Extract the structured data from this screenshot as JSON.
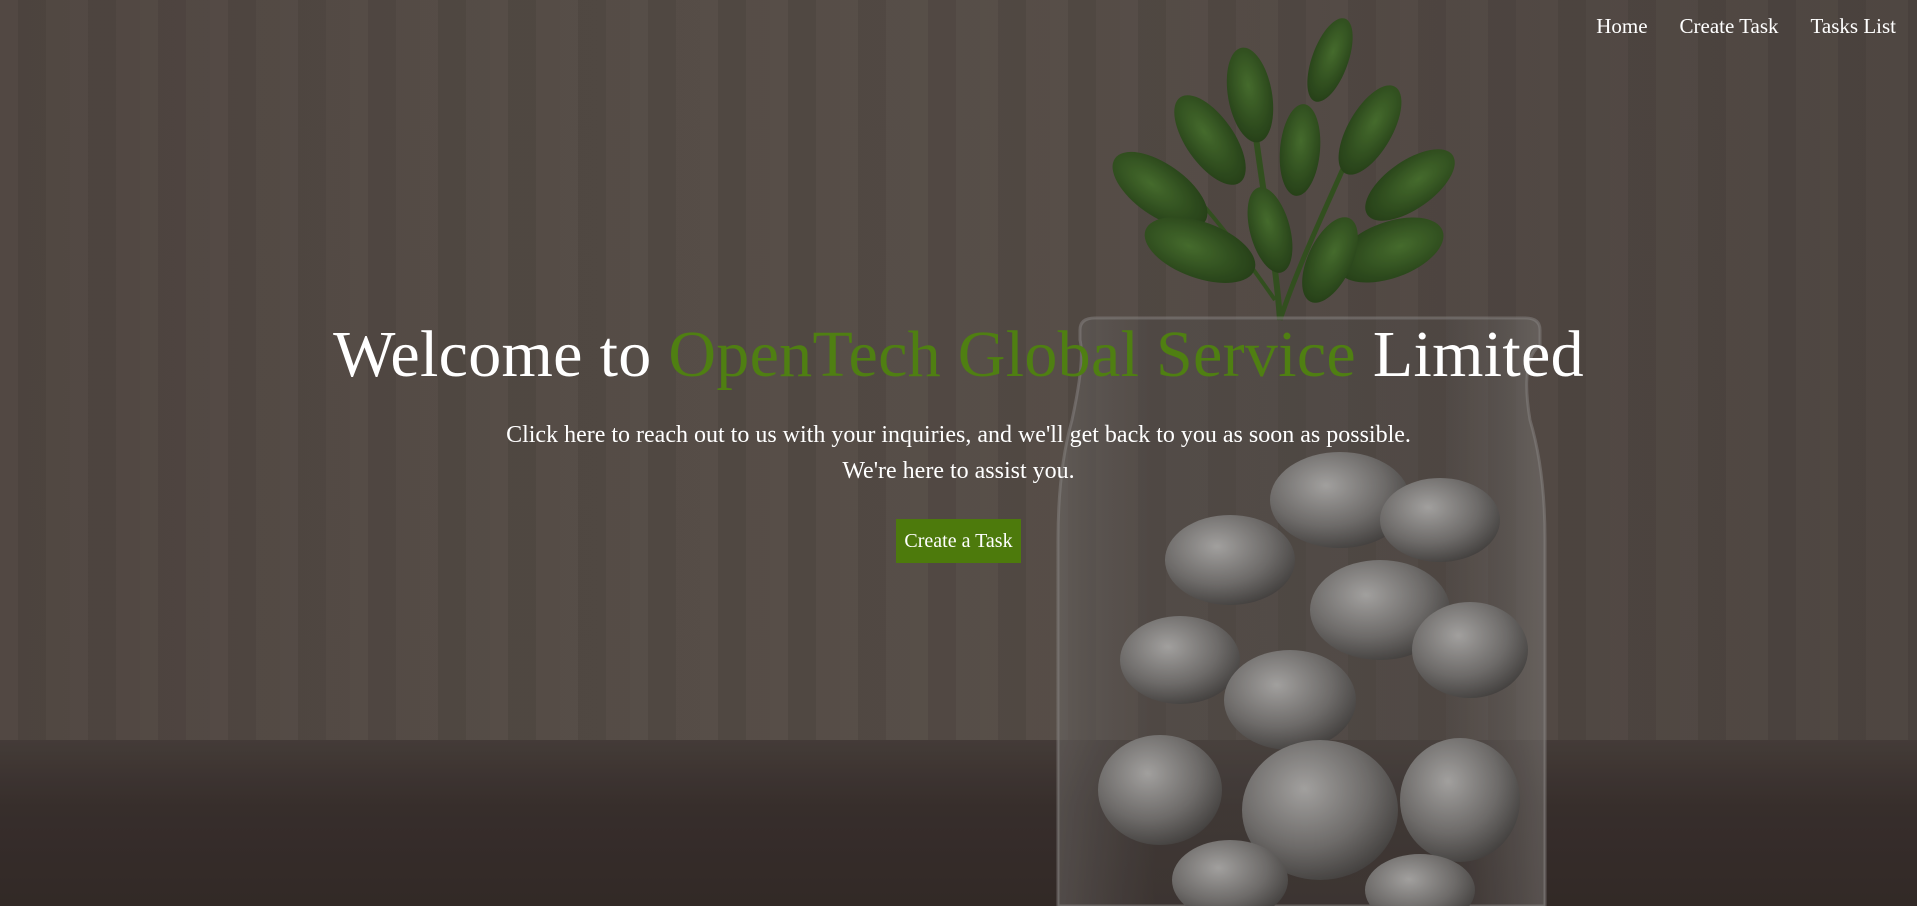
{
  "nav": {
    "items": [
      {
        "label": "Home"
      },
      {
        "label": "Create Task"
      },
      {
        "label": "Tasks List"
      }
    ]
  },
  "hero": {
    "title_prefix": "Welcome to",
    "title_brand": "OpenTech Global Service",
    "title_suffix": "Limited",
    "subtitle_line1": "Click here to reach out to us with your inquiries, and we'll get back to you as soon as possible.",
    "subtitle_line2": "We're here to assist you.",
    "cta_label": "Create a Task"
  },
  "colors": {
    "accent": "#4d7a0c",
    "brand_text": "#4f7f12",
    "text": "#ffffff"
  },
  "background": {
    "image": "plant-in-coin-jar-photo"
  }
}
